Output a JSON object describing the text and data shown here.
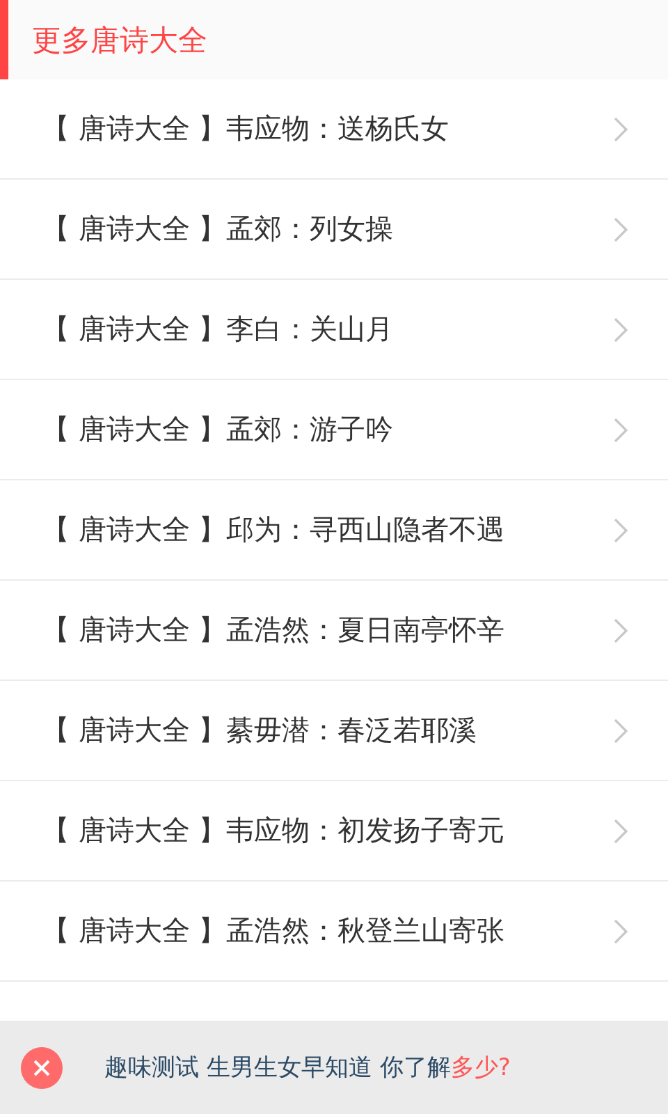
{
  "header": {
    "title": "更多唐诗大全"
  },
  "items": [
    {
      "label": "【 唐诗大全 】韦应物：送杨氏女"
    },
    {
      "label": "【 唐诗大全 】孟郊：列女操"
    },
    {
      "label": "【 唐诗大全 】李白：关山月"
    },
    {
      "label": "【 唐诗大全 】孟郊：游子吟"
    },
    {
      "label": "【 唐诗大全 】邱为：寻西山隐者不遇"
    },
    {
      "label": "【 唐诗大全 】孟浩然：夏日南亭怀辛"
    },
    {
      "label": "【 唐诗大全 】綦毋潜：春泛若耶溪"
    },
    {
      "label": "【 唐诗大全 】韦应物：初发扬子寄元"
    },
    {
      "label": "【 唐诗大全 】孟浩然：秋登兰山寄张"
    }
  ],
  "banner": {
    "text": "趣味测试 生男生女早知道 你了解",
    "highlight": "多少?"
  }
}
